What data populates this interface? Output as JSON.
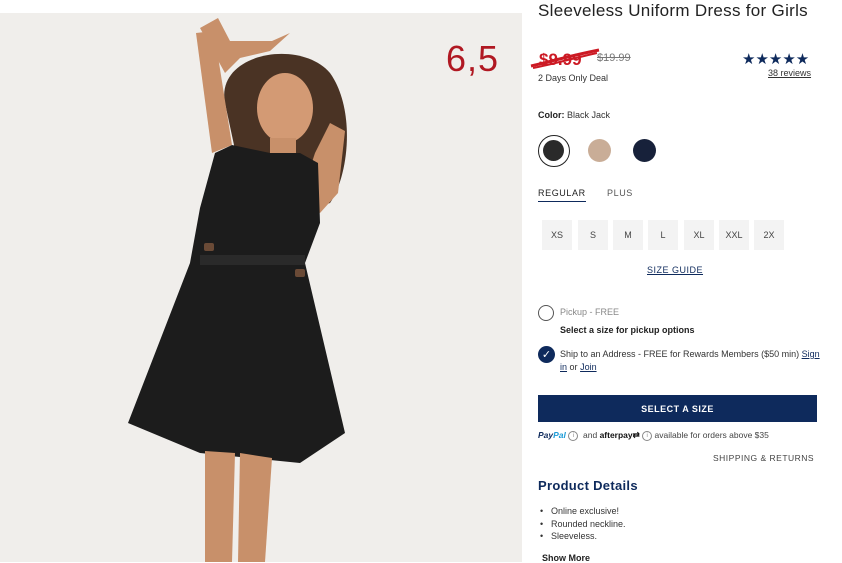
{
  "annotation": "6,5",
  "product": {
    "title": "Sleeveless Uniform Dress for Girls",
    "sale_price": "$9.99",
    "original_price": "$19.99",
    "deal_text": "2 Days Only Deal",
    "rating_stars": "★★★★★",
    "reviews": "38 reviews"
  },
  "color": {
    "label": "Color:",
    "selected": "Black Jack",
    "swatches": [
      {
        "name": "black-jack",
        "hex": "#2a2a2a"
      },
      {
        "name": "tan",
        "hex": "#c9ad97"
      },
      {
        "name": "navy",
        "hex": "#17213a"
      }
    ]
  },
  "fit_tabs": [
    "REGULAR",
    "PLUS"
  ],
  "sizes": [
    "XS",
    "S",
    "M",
    "L",
    "XL",
    "XXL",
    "2X"
  ],
  "size_guide": "SIZE GUIDE",
  "fulfillment": {
    "pickup_label": "Pickup - FREE",
    "pickup_note": "Select a size for pickup options",
    "ship_text": "Ship to an Address - FREE for Rewards Members ($50 min)",
    "sign_in": "Sign in",
    "or": "or",
    "join": "Join"
  },
  "cta": "SELECT A SIZE",
  "payment": {
    "paypal_a": "Pay",
    "paypal_b": "Pal",
    "and": "and",
    "afterpay": "afterpay",
    "note": "available for orders above $35"
  },
  "shipping_returns": "SHIPPING & RETURNS",
  "details": {
    "title": "Product Details",
    "items": [
      "Online exclusive!",
      "Rounded neckline.",
      "Sleeveless."
    ],
    "show_more": "Show More"
  },
  "colors": {
    "navy": "#0e2a5c",
    "sale_red": "#cc1a24",
    "annotation_red": "#b01822"
  }
}
